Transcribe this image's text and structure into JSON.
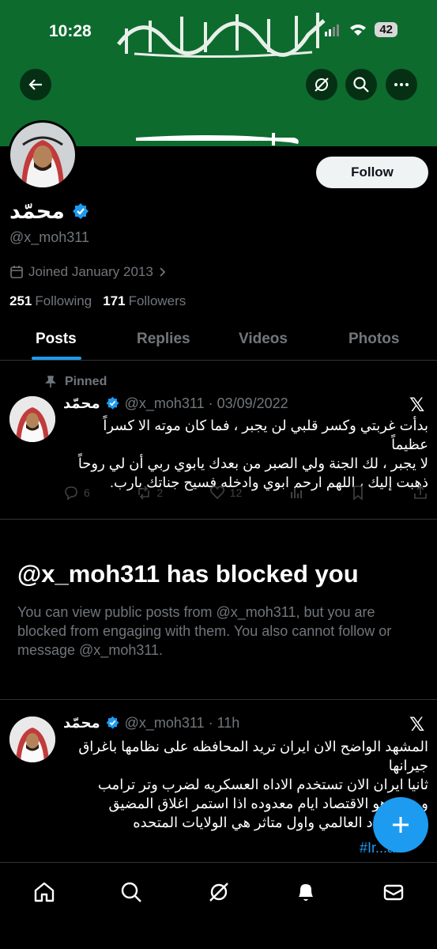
{
  "status_bar": {
    "time": "10:28",
    "battery": "42"
  },
  "header": {
    "back_icon": "arrow-left-icon",
    "grok_icon": "grok-icon",
    "search_icon": "search-icon",
    "more_icon": "more-icon"
  },
  "profile": {
    "name": "محمّد",
    "handle": "@x_moh311",
    "joined": "Joined January 2013",
    "following_count": "251",
    "following_label": "Following",
    "followers_count": "171",
    "followers_label": "Followers",
    "follow_label": "Follow"
  },
  "tabs": [
    {
      "label": "Posts"
    },
    {
      "label": "Replies"
    },
    {
      "label": "Videos"
    },
    {
      "label": "Photos"
    }
  ],
  "pinned_tweet": {
    "pinned_label": "Pinned",
    "name": "محمّد",
    "handle_date": "@x_moh311 · 03/09/2022",
    "text_lines": [
      "بدأت غربتي وكسر قلبي لن يجبر ، فما كان موته الا كسراً عظيماً",
      "لا يجبر ، لك الجنة ولي الصبر من بعدك يابوي ربي أن لي روحاً",
      "ذهبت إليك ، اللهم ارحم ابوي وادخله فسيح جناتك يارب."
    ],
    "replies": "6",
    "reposts": "2",
    "likes": "12"
  },
  "blocked": {
    "title": "@x_moh311 has blocked you",
    "description": "You can view public posts from @x_moh311, but you are blocked from engaging with them. You also cannot follow or message @x_moh311."
  },
  "second_tweet": {
    "name": "محمّد",
    "handle_time": "@x_moh311 · 11h",
    "text_lines": [
      "المشهد الواضح الان ايران تريد المحافظه على نظامها باغراق",
      "جيرانها",
      "ثانيا ايران الان تستخدم الاداه العسكريه لضرب وتر ترامب",
      "و... ه وهو الاقتصاد ايام معدوده اذا استمر اغلاق المضيق",
      "... الاقتصاد العالمي واول متاثر هي الولايات المتحده"
    ],
    "hashtag": "#Ir...ar"
  },
  "colors": {
    "accent": "#1d9bf0",
    "banner": "#0d6b2e"
  }
}
